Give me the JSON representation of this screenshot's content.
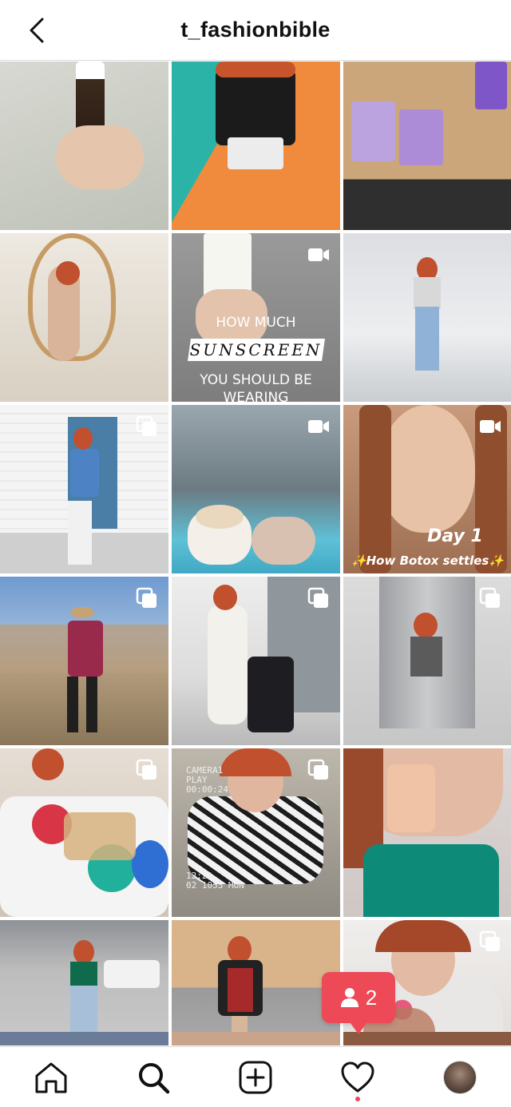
{
  "header": {
    "title": "t_fashionbible"
  },
  "grid": {
    "tiles": [
      {
        "name": "post-serum-bottle",
        "badge": "none",
        "colors": [
          "#c9ccc4",
          "#e7d3c0"
        ]
      },
      {
        "name": "post-mickey-shirt",
        "badge": "none",
        "colors": [
          "#2bb3a8",
          "#f08a3c"
        ]
      },
      {
        "name": "post-drinks",
        "badge": "none",
        "colors": [
          "#caa67a",
          "#9c7ad9"
        ]
      },
      {
        "name": "post-egg-chair",
        "badge": "none",
        "colors": [
          "#e8e2d8",
          "#c79c64"
        ]
      },
      {
        "name": "post-sunscreen",
        "badge": "video",
        "colors": [
          "#8b8b8b",
          "#d9cfc4"
        ]
      },
      {
        "name": "post-garage-jeans",
        "badge": "none",
        "colors": [
          "#e9eaec",
          "#b4b8bf"
        ]
      },
      {
        "name": "post-blue-door",
        "badge": "carousel",
        "colors": [
          "#f2f2f2",
          "#4b7ea6"
        ]
      },
      {
        "name": "post-crowd",
        "badge": "video",
        "colors": [
          "#7c8a93",
          "#5fc0d6"
        ]
      },
      {
        "name": "post-botox",
        "badge": "video",
        "colors": [
          "#d6b39c",
          "#a0745d"
        ]
      },
      {
        "name": "post-cowboy-boots",
        "badge": "carousel",
        "colors": [
          "#87a9cc",
          "#9c8a70"
        ]
      },
      {
        "name": "post-suitcase",
        "badge": "carousel",
        "colors": [
          "#e6e6e6",
          "#b7b7b7"
        ]
      },
      {
        "name": "post-elevator",
        "badge": "carousel",
        "colors": [
          "#d9d9d9",
          "#9a9a9a"
        ]
      },
      {
        "name": "post-balloons",
        "badge": "carousel",
        "colors": [
          "#e0d7cf",
          "#d33a3a"
        ]
      },
      {
        "name": "post-zebra-top",
        "badge": "carousel",
        "colors": [
          "#b9b2a7",
          "#6e6a64"
        ]
      },
      {
        "name": "post-perfume",
        "badge": "none",
        "colors": [
          "#dcd7d6",
          "#0e8b78"
        ]
      },
      {
        "name": "post-parking-green",
        "badge": "none",
        "colors": [
          "#c6c6c6",
          "#6f737a"
        ]
      },
      {
        "name": "post-parking-jacket",
        "badge": "none",
        "colors": [
          "#d9b48a",
          "#8a8a8a"
        ]
      },
      {
        "name": "post-heart-sweater",
        "badge": "carousel",
        "colors": [
          "#ece9e8",
          "#e65a7c"
        ]
      }
    ],
    "sunscreen_text": {
      "line1": "HOW MUCH",
      "line2": "SUNSCREEN",
      "line3": "YOU SHOULD BE",
      "line4": "WEARING"
    },
    "botox_text": {
      "day": "Day 1",
      "caption": "✨How Botox settles✨"
    },
    "camera_text": {
      "line1": "CAMERA1",
      "line2": "PLAY",
      "line3": "00:00:24",
      "line4": "12:21",
      "line5": "02 1053 MON"
    }
  },
  "notification": {
    "count": "2"
  },
  "bottom_nav": {
    "items": [
      "home",
      "search",
      "new-post",
      "activity",
      "profile"
    ]
  }
}
